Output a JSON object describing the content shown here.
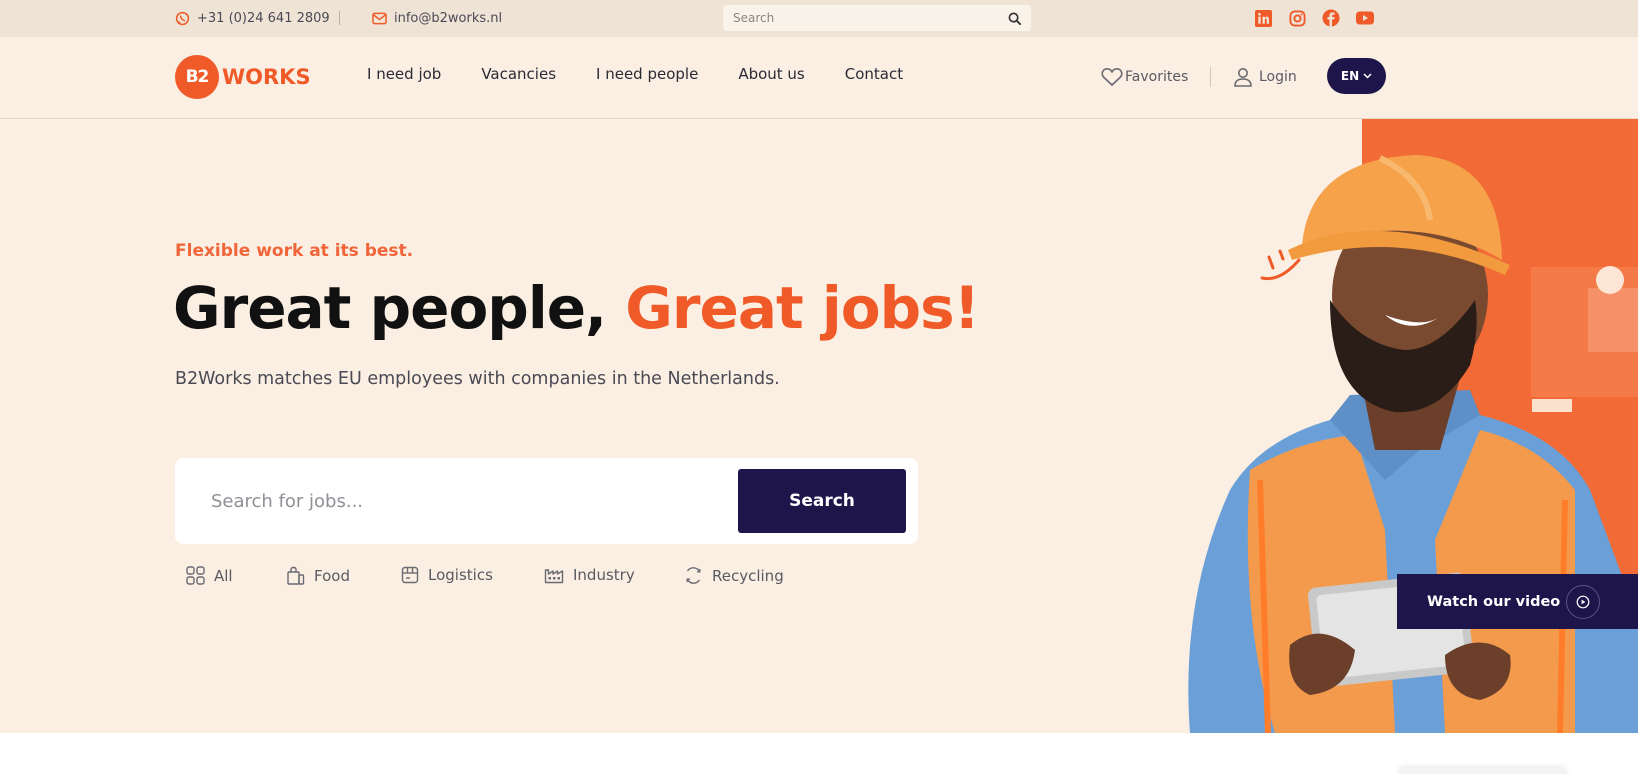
{
  "topbar": {
    "phone": "+31 (0)24 641 2809",
    "email": "info@b2works.nl",
    "search_placeholder": "Search",
    "socials": [
      "linkedin-icon",
      "instagram-icon",
      "facebook-icon",
      "youtube-icon"
    ]
  },
  "header": {
    "logo_mark": "B2",
    "logo_word": "WORKS",
    "nav": [
      "I need job",
      "Vacancies",
      "I need people",
      "About us",
      "Contact"
    ],
    "favorites_label": "Favorites",
    "login_label": "Login",
    "language": "EN"
  },
  "hero": {
    "eyebrow": "Flexible work at its best.",
    "title_main": "Great people, ",
    "title_accent": "Great jobs!",
    "subtitle": "B2Works matches EU employees with companies in the Netherlands.",
    "search_placeholder": "Search for jobs...",
    "search_button": "Search",
    "categories": [
      {
        "label": "All",
        "icon": "grid-icon"
      },
      {
        "label": "Food",
        "icon": "shopping-bag-icon"
      },
      {
        "label": "Logistics",
        "icon": "package-icon"
      },
      {
        "label": "Industry",
        "icon": "factory-icon"
      },
      {
        "label": "Recycling",
        "icon": "recycle-icon"
      }
    ],
    "video_button": "Watch our video"
  },
  "colors": {
    "brand_orange": "#f05a28",
    "brand_navy": "#1e164b",
    "background": "#faefe2",
    "topbar": "#efe3d6"
  }
}
